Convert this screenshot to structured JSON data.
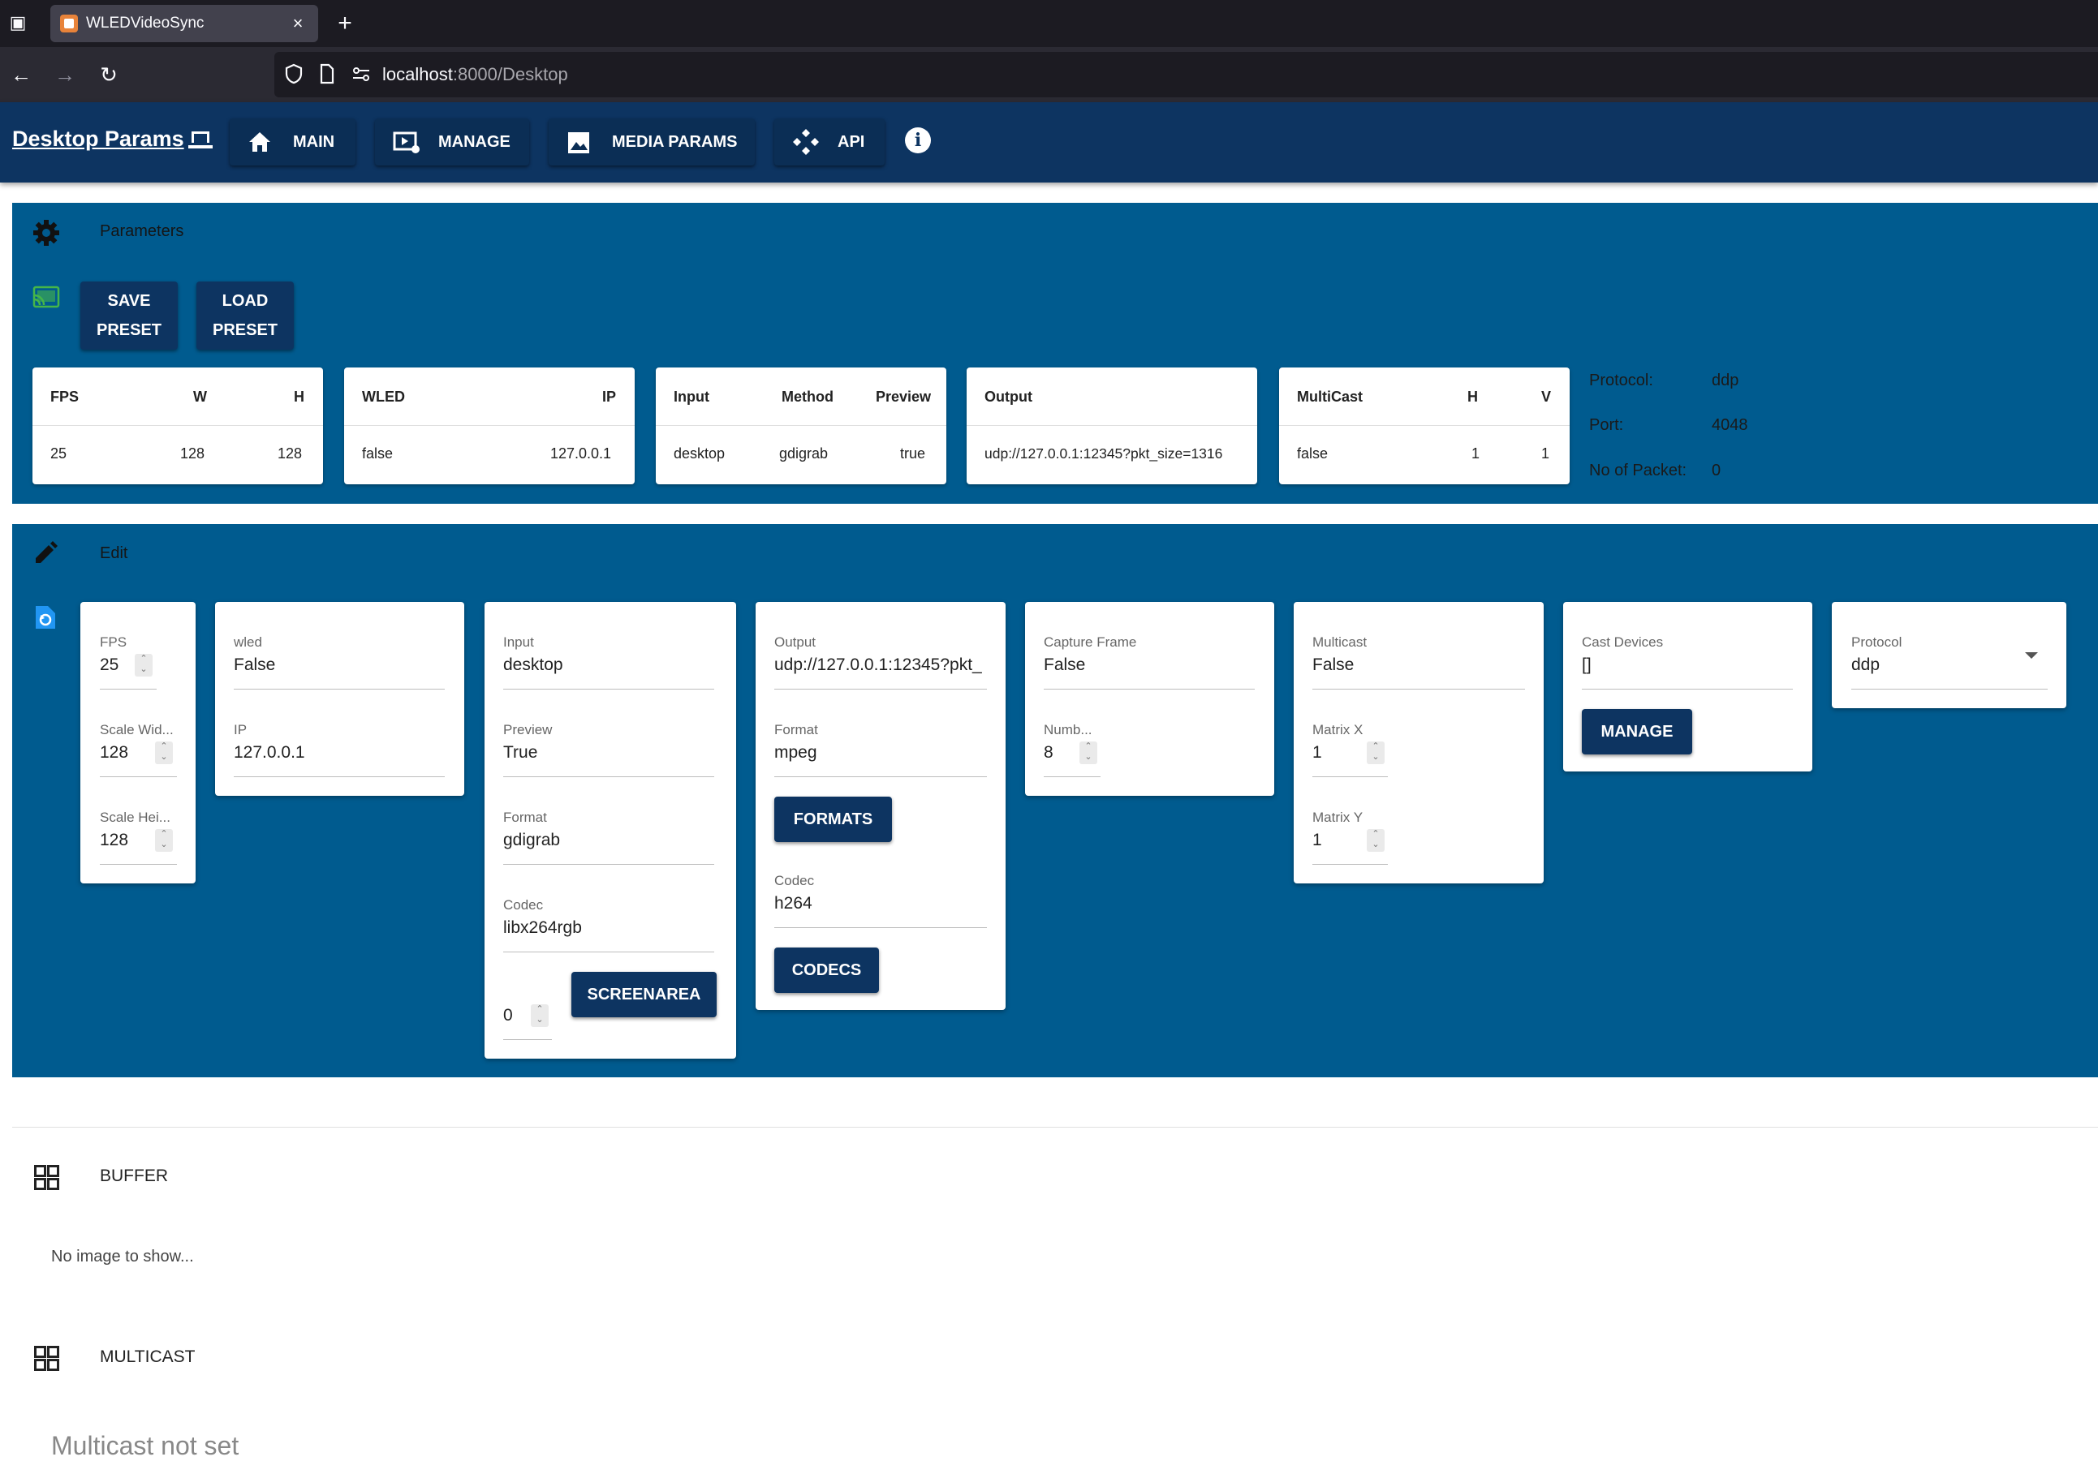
{
  "browser": {
    "tab_title": "WLEDVideoSync",
    "url_host": "localhost",
    "url_path": ":8000/Desktop"
  },
  "header": {
    "title": "Desktop Params",
    "nav": [
      {
        "label": "MAIN",
        "icon": "home-icon"
      },
      {
        "label": "MANAGE",
        "icon": "video-settings-icon"
      },
      {
        "label": "MEDIA PARAMS",
        "icon": "image-icon"
      },
      {
        "label": "API",
        "icon": "api-icon"
      }
    ],
    "colors": {
      "appbar": "#0d3461",
      "panel": "#005b8f",
      "button": "#0d3461"
    }
  },
  "parameters": {
    "title": "Parameters",
    "save_preset": [
      "SAVE",
      "PRESET"
    ],
    "load_preset": [
      "LOAD",
      "PRESET"
    ],
    "tables": {
      "fps": {
        "headers": [
          "FPS",
          "W",
          "H"
        ],
        "values": [
          "25",
          "128",
          "128"
        ]
      },
      "wled": {
        "headers": [
          "WLED",
          "IP"
        ],
        "values": [
          "false",
          "127.0.0.1"
        ]
      },
      "input": {
        "headers": [
          "Input",
          "Method",
          "Preview"
        ],
        "values": [
          "desktop",
          "gdigrab",
          "true"
        ]
      },
      "output": {
        "headers": [
          "Output"
        ],
        "values": [
          "udp://127.0.0.1:12345?pkt_size=1316"
        ]
      },
      "multicast": {
        "headers": [
          "MultiCast",
          "H",
          "V"
        ],
        "values": [
          "false",
          "1",
          "1"
        ]
      }
    },
    "protocol": {
      "protocol_label": "Protocol:",
      "protocol_value": "ddp",
      "port_label": "Port:",
      "port_value": "4048",
      "packets_label": "No of Packet:",
      "packets_value": "0"
    }
  },
  "edit": {
    "title": "Edit",
    "fps_card": {
      "fps_label": "FPS",
      "fps_value": "25",
      "scale_width_label": "Scale Wid...",
      "scale_width_value": "128",
      "scale_height_label": "Scale Hei...",
      "scale_height_value": "128"
    },
    "wled_card": {
      "wled_label": "wled",
      "wled_value": "False",
      "ip_label": "IP",
      "ip_value": "127.0.0.1"
    },
    "input_card": {
      "input_label": "Input",
      "input_value": "desktop",
      "preview_label": "Preview",
      "preview_value": "True",
      "format_label": "Format",
      "format_value": "gdigrab",
      "codec_label": "Codec",
      "codec_value": "libx264rgb",
      "monitor_value": "0",
      "screenarea_button": "SCREENAREA"
    },
    "output_card": {
      "output_label": "Output",
      "output_value": "udp://127.0.0.1:12345?pkt_",
      "format_label": "Format",
      "format_value": "mpeg",
      "formats_button": "FORMATS",
      "codec_label": "Codec",
      "codec_value": "h264",
      "codecs_button": "CODECS"
    },
    "capture_card": {
      "capture_label": "Capture Frame",
      "capture_value": "False",
      "number_label": "Numb...",
      "number_value": "8"
    },
    "multicast_card": {
      "multicast_label": "Multicast",
      "multicast_value": "False",
      "matrix_x_label": "Matrix X",
      "matrix_x_value": "1",
      "matrix_y_label": "Matrix Y",
      "matrix_y_value": "1"
    },
    "cast_card": {
      "cast_label": "Cast Devices",
      "cast_value": "[]",
      "manage_button": "MANAGE"
    },
    "protocol_card": {
      "protocol_label": "Protocol",
      "protocol_value": "ddp"
    }
  },
  "buffer": {
    "title": "BUFFER",
    "empty_text": "No image to show..."
  },
  "multicast": {
    "title": "MULTICAST",
    "empty_text": "Multicast not set"
  }
}
